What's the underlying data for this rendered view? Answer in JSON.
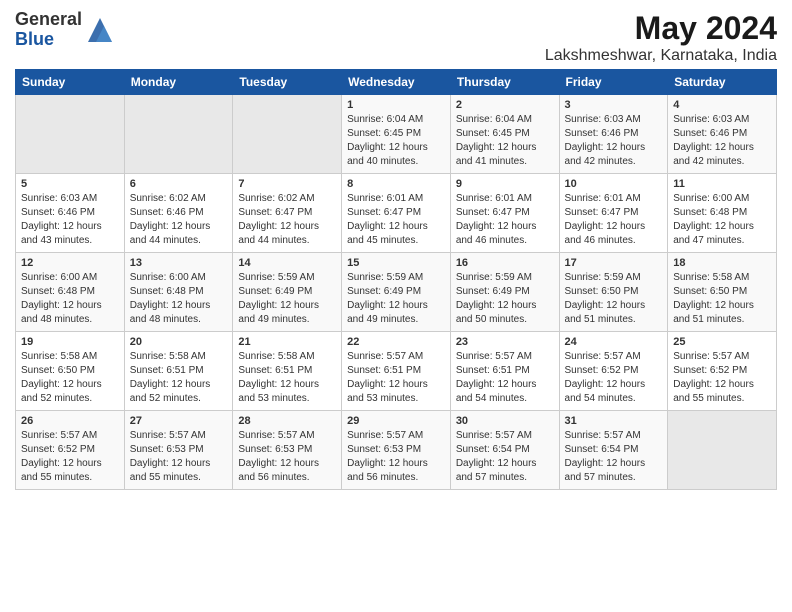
{
  "logo": {
    "general": "General",
    "blue": "Blue"
  },
  "title": "May 2024",
  "subtitle": "Lakshmeshwar, Karnataka, India",
  "days_of_week": [
    "Sunday",
    "Monday",
    "Tuesday",
    "Wednesday",
    "Thursday",
    "Friday",
    "Saturday"
  ],
  "weeks": [
    [
      {
        "day": "",
        "info": ""
      },
      {
        "day": "",
        "info": ""
      },
      {
        "day": "",
        "info": ""
      },
      {
        "day": "1",
        "info": "Sunrise: 6:04 AM\nSunset: 6:45 PM\nDaylight: 12 hours\nand 40 minutes."
      },
      {
        "day": "2",
        "info": "Sunrise: 6:04 AM\nSunset: 6:45 PM\nDaylight: 12 hours\nand 41 minutes."
      },
      {
        "day": "3",
        "info": "Sunrise: 6:03 AM\nSunset: 6:46 PM\nDaylight: 12 hours\nand 42 minutes."
      },
      {
        "day": "4",
        "info": "Sunrise: 6:03 AM\nSunset: 6:46 PM\nDaylight: 12 hours\nand 42 minutes."
      }
    ],
    [
      {
        "day": "5",
        "info": "Sunrise: 6:03 AM\nSunset: 6:46 PM\nDaylight: 12 hours\nand 43 minutes."
      },
      {
        "day": "6",
        "info": "Sunrise: 6:02 AM\nSunset: 6:46 PM\nDaylight: 12 hours\nand 44 minutes."
      },
      {
        "day": "7",
        "info": "Sunrise: 6:02 AM\nSunset: 6:47 PM\nDaylight: 12 hours\nand 44 minutes."
      },
      {
        "day": "8",
        "info": "Sunrise: 6:01 AM\nSunset: 6:47 PM\nDaylight: 12 hours\nand 45 minutes."
      },
      {
        "day": "9",
        "info": "Sunrise: 6:01 AM\nSunset: 6:47 PM\nDaylight: 12 hours\nand 46 minutes."
      },
      {
        "day": "10",
        "info": "Sunrise: 6:01 AM\nSunset: 6:47 PM\nDaylight: 12 hours\nand 46 minutes."
      },
      {
        "day": "11",
        "info": "Sunrise: 6:00 AM\nSunset: 6:48 PM\nDaylight: 12 hours\nand 47 minutes."
      }
    ],
    [
      {
        "day": "12",
        "info": "Sunrise: 6:00 AM\nSunset: 6:48 PM\nDaylight: 12 hours\nand 48 minutes."
      },
      {
        "day": "13",
        "info": "Sunrise: 6:00 AM\nSunset: 6:48 PM\nDaylight: 12 hours\nand 48 minutes."
      },
      {
        "day": "14",
        "info": "Sunrise: 5:59 AM\nSunset: 6:49 PM\nDaylight: 12 hours\nand 49 minutes."
      },
      {
        "day": "15",
        "info": "Sunrise: 5:59 AM\nSunset: 6:49 PM\nDaylight: 12 hours\nand 49 minutes."
      },
      {
        "day": "16",
        "info": "Sunrise: 5:59 AM\nSunset: 6:49 PM\nDaylight: 12 hours\nand 50 minutes."
      },
      {
        "day": "17",
        "info": "Sunrise: 5:59 AM\nSunset: 6:50 PM\nDaylight: 12 hours\nand 51 minutes."
      },
      {
        "day": "18",
        "info": "Sunrise: 5:58 AM\nSunset: 6:50 PM\nDaylight: 12 hours\nand 51 minutes."
      }
    ],
    [
      {
        "day": "19",
        "info": "Sunrise: 5:58 AM\nSunset: 6:50 PM\nDaylight: 12 hours\nand 52 minutes."
      },
      {
        "day": "20",
        "info": "Sunrise: 5:58 AM\nSunset: 6:51 PM\nDaylight: 12 hours\nand 52 minutes."
      },
      {
        "day": "21",
        "info": "Sunrise: 5:58 AM\nSunset: 6:51 PM\nDaylight: 12 hours\nand 53 minutes."
      },
      {
        "day": "22",
        "info": "Sunrise: 5:57 AM\nSunset: 6:51 PM\nDaylight: 12 hours\nand 53 minutes."
      },
      {
        "day": "23",
        "info": "Sunrise: 5:57 AM\nSunset: 6:51 PM\nDaylight: 12 hours\nand 54 minutes."
      },
      {
        "day": "24",
        "info": "Sunrise: 5:57 AM\nSunset: 6:52 PM\nDaylight: 12 hours\nand 54 minutes."
      },
      {
        "day": "25",
        "info": "Sunrise: 5:57 AM\nSunset: 6:52 PM\nDaylight: 12 hours\nand 55 minutes."
      }
    ],
    [
      {
        "day": "26",
        "info": "Sunrise: 5:57 AM\nSunset: 6:52 PM\nDaylight: 12 hours\nand 55 minutes."
      },
      {
        "day": "27",
        "info": "Sunrise: 5:57 AM\nSunset: 6:53 PM\nDaylight: 12 hours\nand 55 minutes."
      },
      {
        "day": "28",
        "info": "Sunrise: 5:57 AM\nSunset: 6:53 PM\nDaylight: 12 hours\nand 56 minutes."
      },
      {
        "day": "29",
        "info": "Sunrise: 5:57 AM\nSunset: 6:53 PM\nDaylight: 12 hours\nand 56 minutes."
      },
      {
        "day": "30",
        "info": "Sunrise: 5:57 AM\nSunset: 6:54 PM\nDaylight: 12 hours\nand 57 minutes."
      },
      {
        "day": "31",
        "info": "Sunrise: 5:57 AM\nSunset: 6:54 PM\nDaylight: 12 hours\nand 57 minutes."
      },
      {
        "day": "",
        "info": ""
      }
    ]
  ]
}
